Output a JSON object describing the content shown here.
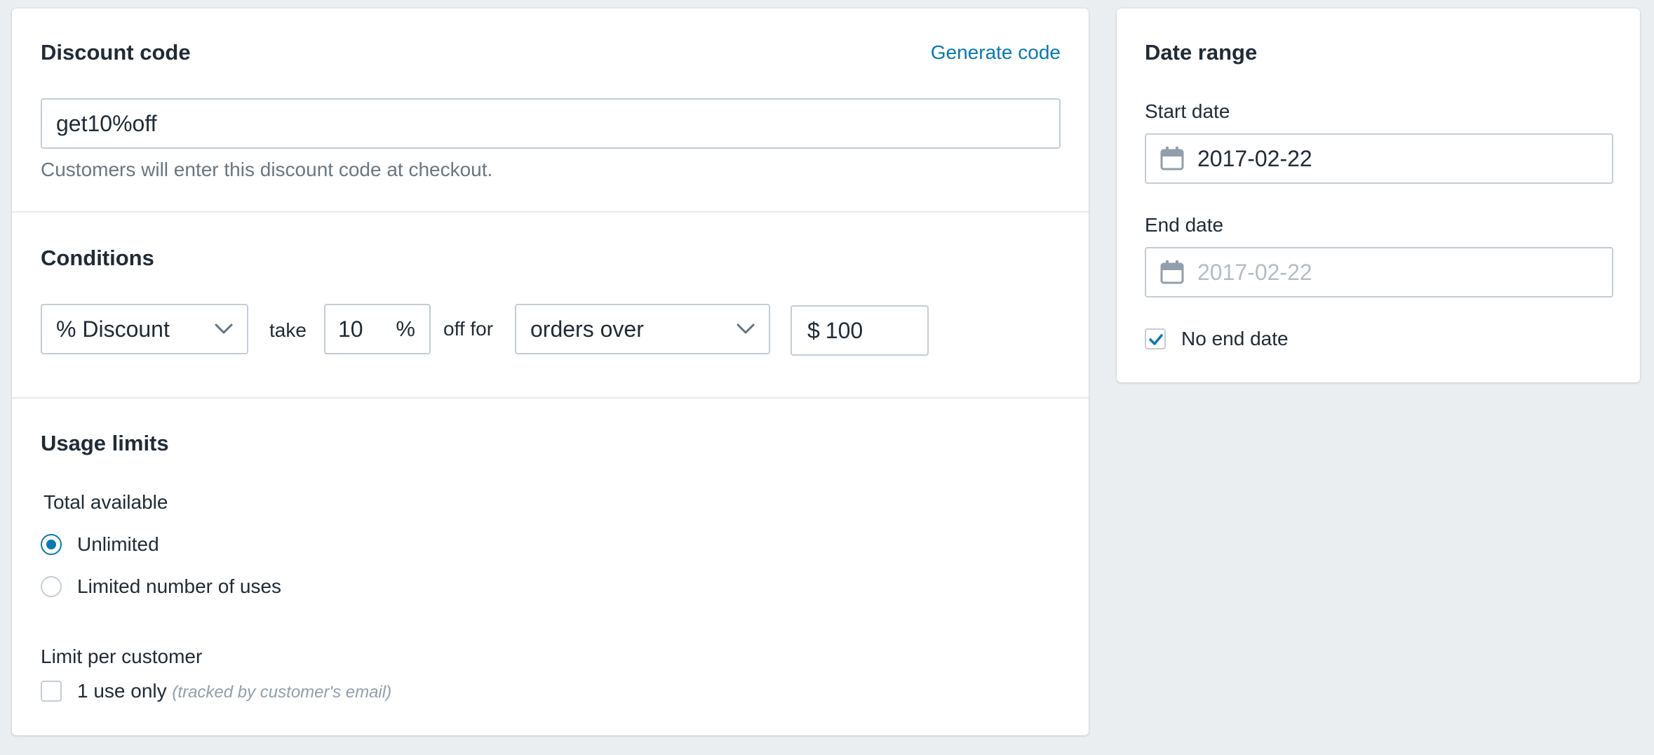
{
  "discount": {
    "title": "Discount code",
    "generate_link": "Generate code",
    "code_value": "get10%off",
    "help_text": "Customers will enter this discount code at checkout."
  },
  "conditions": {
    "title": "Conditions",
    "type_select": "% Discount",
    "take_label": "take",
    "amount_value": "10",
    "amount_suffix": "%",
    "off_for_label": "off for",
    "scope_select": "orders over",
    "min_prefix": "$",
    "min_value": "100"
  },
  "usage": {
    "title": "Usage limits",
    "total_label": "Total available",
    "options": [
      {
        "label": "Unlimited",
        "selected": true
      },
      {
        "label": "Limited number of uses",
        "selected": false
      }
    ],
    "per_customer_label": "Limit per customer",
    "per_customer_option": "1 use only",
    "per_customer_note": "(tracked by customer's email)",
    "per_customer_checked": false
  },
  "date_range": {
    "title": "Date range",
    "start_label": "Start date",
    "start_value": "2017-02-22",
    "end_label": "End date",
    "end_placeholder": "2017-02-22",
    "no_end_label": "No end date",
    "no_end_checked": true
  },
  "icons": {
    "calendar": "calendar-icon",
    "chevron": "chevron-down-icon",
    "check": "checkmark-icon"
  },
  "colors": {
    "background": "#ebeef0",
    "accent": "#0a78b4",
    "border": "#c4cdd5",
    "text": "#212b36",
    "muted_text": "#6b7680"
  }
}
